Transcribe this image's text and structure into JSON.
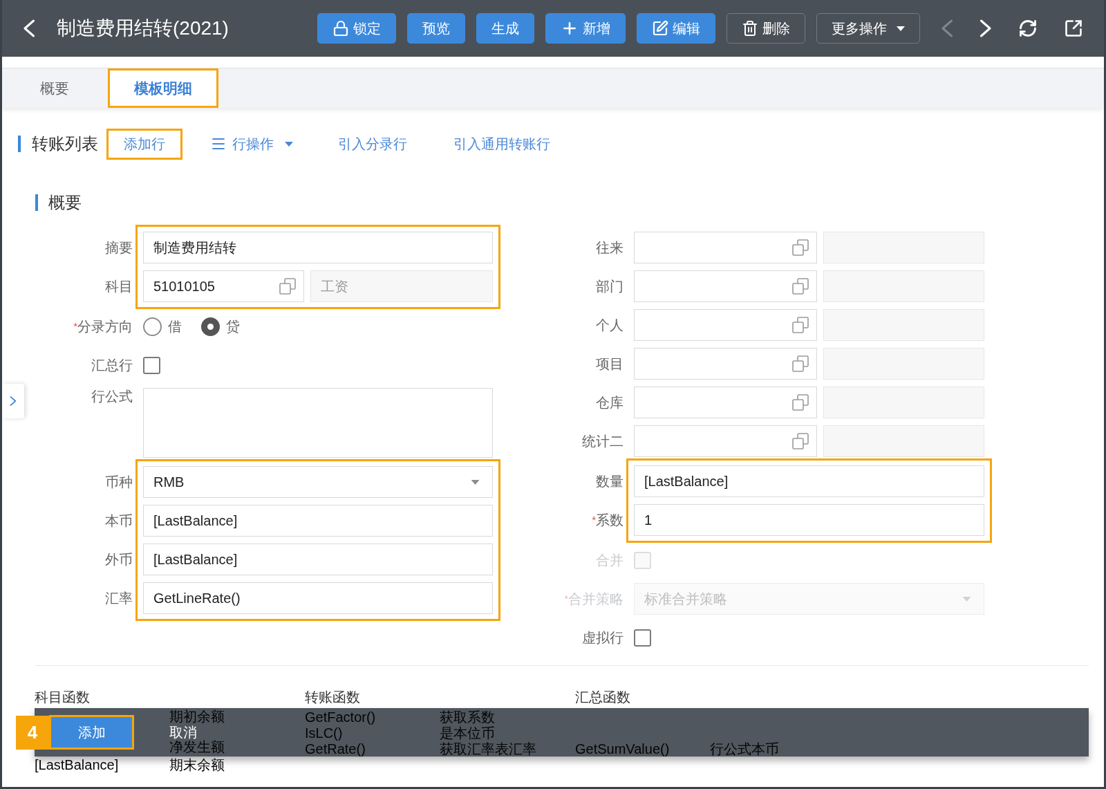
{
  "header": {
    "title": "制造费用结转(2021)",
    "buttons": [
      {
        "label": "锁定",
        "kind": "primary"
      },
      {
        "label": "预览",
        "kind": "primary"
      },
      {
        "label": "生成",
        "kind": "primary"
      },
      {
        "label": "新增",
        "kind": "primary"
      },
      {
        "label": "编辑",
        "kind": "primary"
      },
      {
        "label": "删除",
        "kind": "outline"
      },
      {
        "label": "更多操作",
        "kind": "dropdown"
      }
    ],
    "pager": [
      {
        "kind": "previous",
        "disabled": true
      },
      {
        "kind": "next",
        "disabled": false
      }
    ]
  },
  "tabs": [
    {
      "label": "概要",
      "selected": false,
      "highlighted": false
    },
    {
      "label": "模板明细",
      "selected": true,
      "highlighted": true
    }
  ],
  "toolbar": {
    "title": "转账列表",
    "actions": [
      {
        "label": "添加行",
        "kind": "link",
        "highlighted": true
      },
      {
        "label": "行操作",
        "kind": "menu",
        "highlighted": false
      },
      {
        "label": "引入分录行",
        "kind": "link",
        "highlighted": false
      },
      {
        "label": "引入通用转账行",
        "kind": "link",
        "highlighted": false
      }
    ]
  },
  "section": {
    "title": "概要",
    "left_fields": [
      {
        "kind": "text",
        "label": "摘要",
        "value": "制造费用结转",
        "disabled": false,
        "highlighted": true
      },
      {
        "kind": "lookup",
        "label": "科目",
        "value": "51010105",
        "name_value": "工资",
        "disabled": false,
        "highlighted": true
      },
      {
        "kind": "radio",
        "label": "分录方向",
        "required_mark": "*",
        "options": [
          {
            "label": "借",
            "selected": false
          },
          {
            "label": "贷",
            "selected": true
          }
        ],
        "disabled": false,
        "highlighted": false
      },
      {
        "kind": "checkbox",
        "label": "汇总行",
        "checked": false,
        "disabled": false,
        "highlighted": false
      },
      {
        "kind": "textarea",
        "label": "行公式",
        "disabled": false,
        "highlighted": false
      },
      {
        "kind": "select",
        "label": "币种",
        "value": "RMB",
        "disabled": false,
        "highlighted": true
      },
      {
        "kind": "text",
        "label": "本币",
        "value": "[LastBalance]",
        "disabled": false,
        "highlighted": true
      },
      {
        "kind": "text",
        "label": "外币",
        "value": "[LastBalance]",
        "disabled": false,
        "highlighted": true
      },
      {
        "kind": "text",
        "label": "汇率",
        "value": "GetLineRate()",
        "disabled": false,
        "highlighted": true
      }
    ],
    "right_fields": [
      {
        "kind": "lookup",
        "label": "往来",
        "disabled": false,
        "highlighted": false
      },
      {
        "kind": "lookup",
        "label": "部门",
        "disabled": false,
        "highlighted": false
      },
      {
        "kind": "lookup",
        "label": "个人",
        "disabled": false,
        "highlighted": false
      },
      {
        "kind": "lookup",
        "label": "项目",
        "disabled": false,
        "highlighted": false
      },
      {
        "kind": "lookup",
        "label": "仓库",
        "disabled": false,
        "highlighted": false
      },
      {
        "kind": "lookup",
        "label": "统计二",
        "disabled": false,
        "highlighted": false
      },
      {
        "kind": "text",
        "label": "数量",
        "value": "[LastBalance]",
        "disabled": false,
        "highlighted": true
      },
      {
        "kind": "text",
        "label": "系数",
        "required_mark": "*",
        "value": "1",
        "disabled": false,
        "highlighted": true
      },
      {
        "kind": "checkbox",
        "label": "合并",
        "checked": false,
        "disabled": true,
        "highlighted": false
      },
      {
        "kind": "select",
        "label": "合并策略",
        "required_mark": "*",
        "value": "标准合并策略",
        "disabled": true,
        "highlighted": false
      },
      {
        "kind": "checkbox",
        "label": "虚拟行",
        "checked": false,
        "disabled": false,
        "highlighted": false
      }
    ]
  },
  "functions": {
    "columns": [
      {
        "title": "科目函数",
        "rows": [
          {
            "description": "期初余额"
          },
          {
            "description": "净发生额"
          },
          {
            "name": "[LastBalance]",
            "description": "期末余额"
          }
        ]
      },
      {
        "title": "转账函数",
        "rows": [
          {
            "name": "GetFactor()",
            "description": "获取系数"
          },
          {
            "name": "IsLC()",
            "description": "是本位币"
          },
          {
            "name": "GetRate()",
            "description": "获取汇率表汇率"
          }
        ]
      },
      {
        "title": "汇总函数",
        "rows": [
          null,
          null,
          {
            "name": "GetSumValue()",
            "description": "行公式本币"
          }
        ]
      }
    ]
  },
  "action_bar": {
    "step_badge": "4",
    "buttons": [
      {
        "label": "添加",
        "kind": "primary",
        "highlighted": true
      },
      {
        "label": "取消",
        "kind": "text",
        "highlighted": false
      }
    ]
  }
}
